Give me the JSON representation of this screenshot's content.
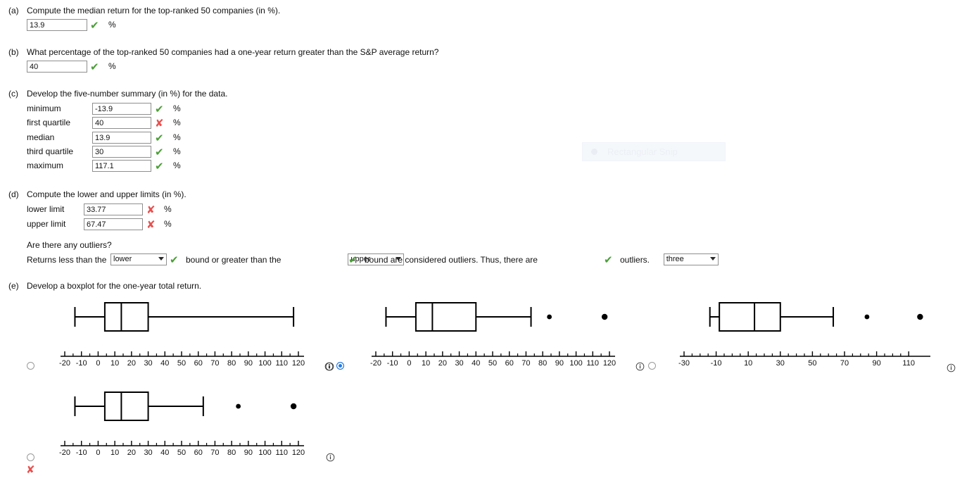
{
  "parts": {
    "a": {
      "letter": "(a)",
      "prompt": "Compute the median return for the top-ranked 50 companies (in %).",
      "value": "13.9",
      "mark": "correct",
      "unit": "%"
    },
    "b": {
      "letter": "(b)",
      "prompt": "What percentage of the top-ranked 50 companies had a one-year return greater than the S&P average return?",
      "value": "40",
      "mark": "correct",
      "unit": "%"
    },
    "c": {
      "letter": "(c)",
      "prompt": "Develop the five-number summary (in %) for the data.",
      "rows": [
        {
          "label": "minimum",
          "value": "-13.9",
          "mark": "correct",
          "unit": "%"
        },
        {
          "label": "first quartile",
          "value": "40",
          "mark": "wrong",
          "unit": "%"
        },
        {
          "label": "median",
          "value": "13.9",
          "mark": "correct",
          "unit": "%"
        },
        {
          "label": "third quartile",
          "value": "30",
          "mark": "correct",
          "unit": "%"
        },
        {
          "label": "maximum",
          "value": "117.1",
          "mark": "correct",
          "unit": "%"
        }
      ]
    },
    "d": {
      "letter": "(d)",
      "prompt": "Compute the lower and upper limits (in %).",
      "rows": [
        {
          "label": "lower limit",
          "value": "33.77",
          "mark": "wrong",
          "unit": "%"
        },
        {
          "label": "upper limit",
          "value": "67.47",
          "mark": "wrong",
          "unit": "%"
        }
      ],
      "outliers_question": "Are there any outliers?",
      "sentence": {
        "lead": "Returns less than the",
        "select_bound_low": "lower",
        "mark_low": "correct",
        "middle": "bound or greater than the",
        "select_bound_high": "upper",
        "mark_high": "correct",
        "tail": "bound are considered outliers. Thus, there are",
        "select_count": "three",
        "mark_count": "correct",
        "end": "outliers."
      }
    },
    "e": {
      "letter": "(e)",
      "prompt": "Develop a boxplot for the one-year total return.",
      "options": [
        {
          "id": "option-a",
          "selected": false,
          "has_info": true,
          "wrong_mark": false
        },
        {
          "id": "option-b",
          "selected": true,
          "has_info": true,
          "wrong_mark": false
        },
        {
          "id": "option-c",
          "selected": false,
          "has_info": true,
          "wrong_mark": false
        },
        {
          "id": "option-d",
          "selected": false,
          "has_info": true,
          "wrong_mark": true
        }
      ]
    }
  },
  "overlay": {
    "snip_label": "Rectangular Snip"
  },
  "icons": {
    "check": "✔",
    "cross": "✘",
    "info": "info-icon"
  },
  "colors": {
    "correct": "#4c9f38",
    "wrong": "#e8514f",
    "radio_selected": "#1e7ae8",
    "plot_stroke": "#000000"
  },
  "chart_data": [
    {
      "id": "boxplot-a",
      "type": "box",
      "title": "",
      "xlabel": "",
      "xlim": [
        -20,
        120
      ],
      "ticks_major": [
        -20,
        -10,
        0,
        10,
        20,
        30,
        40,
        50,
        60,
        70,
        80,
        90,
        100,
        110,
        120
      ],
      "tick_labels": [
        "-20",
        "-10",
        "0",
        "10",
        "20",
        "30",
        "40",
        "50",
        "60",
        "70",
        "80",
        "90",
        "100",
        "110",
        "120"
      ],
      "minor_ticks_between": 1,
      "box": {
        "whisker_low": -13.9,
        "q1": 4.0,
        "median": 13.9,
        "q3": 30.0,
        "whisker_high": 117.1
      },
      "outliers": []
    },
    {
      "id": "boxplot-b",
      "type": "box",
      "title": "",
      "xlabel": "",
      "xlim": [
        -20,
        120
      ],
      "ticks_major": [
        -20,
        -10,
        0,
        10,
        20,
        30,
        40,
        50,
        60,
        70,
        80,
        90,
        100,
        110,
        120
      ],
      "tick_labels": [
        "-20",
        "-10",
        "0",
        "10",
        "20",
        "30",
        "40",
        "50",
        "60",
        "70",
        "80",
        "90",
        "100",
        "110",
        "120"
      ],
      "minor_ticks_between": 1,
      "box": {
        "whisker_low": -13.9,
        "q1": 4.0,
        "median": 13.9,
        "q3": 40.0,
        "whisker_high": 73.0
      },
      "outliers": [
        84.0,
        117.1
      ]
    },
    {
      "id": "boxplot-c",
      "type": "box",
      "title": "",
      "xlabel": "",
      "xlim": [
        -30,
        120
      ],
      "ticks_major": [
        -30,
        -10,
        10,
        30,
        50,
        70,
        90,
        110
      ],
      "tick_labels": [
        "-30",
        "-10",
        "10",
        "30",
        "50",
        "70",
        "90",
        "110"
      ],
      "minor_ticks_between": 3,
      "box": {
        "whisker_low": -13.9,
        "q1": -8.0,
        "median": 13.9,
        "q3": 30.0,
        "whisker_high": 63.0
      },
      "outliers": [
        84.0,
        117.1
      ]
    },
    {
      "id": "boxplot-d",
      "type": "box",
      "title": "",
      "xlabel": "",
      "xlim": [
        -20,
        120
      ],
      "ticks_major": [
        -20,
        -10,
        0,
        10,
        20,
        30,
        40,
        50,
        60,
        70,
        80,
        90,
        100,
        110,
        120
      ],
      "tick_labels": [
        "-20",
        "-10",
        "0",
        "10",
        "20",
        "30",
        "40",
        "50",
        "60",
        "70",
        "80",
        "90",
        "100",
        "110",
        "120"
      ],
      "minor_ticks_between": 1,
      "box": {
        "whisker_low": -13.9,
        "q1": 4.0,
        "median": 13.9,
        "q3": 30.0,
        "whisker_high": 63.0
      },
      "outliers": [
        84.0,
        117.1
      ]
    }
  ]
}
